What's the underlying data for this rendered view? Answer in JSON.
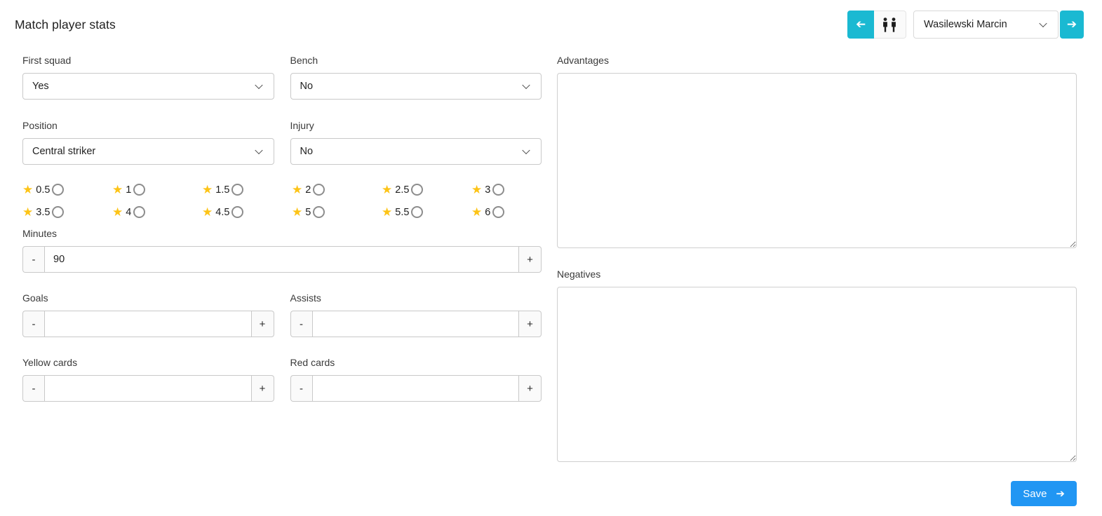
{
  "header": {
    "title": "Match player stats"
  },
  "player_nav": {
    "player": "Wasilewski Marcin"
  },
  "icons": {
    "arrow": "➔",
    "star": "★"
  },
  "fields": {
    "first_squad": {
      "label": "First squad",
      "value": "Yes"
    },
    "bench": {
      "label": "Bench",
      "value": "No"
    },
    "position": {
      "label": "Position",
      "value": "Central striker"
    },
    "injury": {
      "label": "Injury",
      "value": "No"
    },
    "minutes": {
      "label": "Minutes",
      "value": "90"
    },
    "goals": {
      "label": "Goals",
      "value": ""
    },
    "assists": {
      "label": "Assists",
      "value": ""
    },
    "yellow_cards": {
      "label": "Yellow cards",
      "value": ""
    },
    "red_cards": {
      "label": "Red cards",
      "value": ""
    },
    "advantages": {
      "label": "Advantages",
      "value": ""
    },
    "negatives": {
      "label": "Negatives",
      "value": ""
    }
  },
  "rating": {
    "options": [
      "0.5",
      "1",
      "1.5",
      "2",
      "2.5",
      "3",
      "3.5",
      "4",
      "4.5",
      "5",
      "5.5",
      "6"
    ],
    "selected": null
  },
  "stepper": {
    "decrement": "-",
    "increment": "+"
  },
  "actions": {
    "save": "Save"
  },
  "colors": {
    "accent_cyan": "#1ab9d2",
    "primary_blue": "#2196f3",
    "star_yellow": "#fdc417"
  }
}
